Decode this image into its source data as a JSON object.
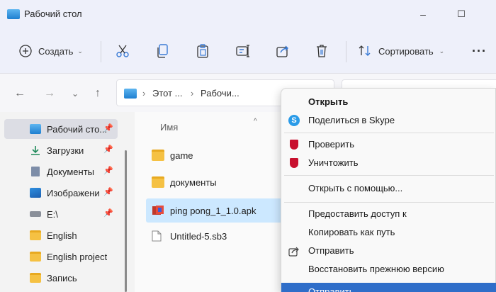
{
  "window": {
    "title": "Рабочий стол",
    "minimize": "–",
    "maximize": "☐"
  },
  "toolbar": {
    "create_label": "Создать",
    "sort_label": "Сортировать",
    "more": "···"
  },
  "nav": {
    "back": "←",
    "forward": "→",
    "recent": "⌄",
    "up": "↑",
    "breadcrumb_sep": "›",
    "breadcrumb": [
      "Этот ...",
      "Рабочи..."
    ]
  },
  "sidebar": {
    "items": [
      {
        "label": "Рабочий сто...",
        "icon": "desktop-icon",
        "pinned": true,
        "selected": true
      },
      {
        "label": "Загрузки",
        "icon": "download-icon",
        "pinned": true
      },
      {
        "label": "Документы",
        "icon": "documents-icon",
        "pinned": true
      },
      {
        "label": "Изображени",
        "icon": "pictures-icon",
        "pinned": true
      },
      {
        "label": "E:\\",
        "icon": "drive-icon",
        "pinned": true
      },
      {
        "label": "English",
        "icon": "folder-icon",
        "pinned": false
      },
      {
        "label": "English project",
        "icon": "folder-icon",
        "pinned": false
      },
      {
        "label": "Запись",
        "icon": "folder-icon",
        "pinned": false
      }
    ],
    "pin_glyph": "📌"
  },
  "filelist": {
    "column_name": "Имя",
    "sort_caret": "^",
    "files": [
      {
        "name": "game",
        "icon": "folder-icon"
      },
      {
        "name": "документы",
        "icon": "folder-icon"
      },
      {
        "name": "ping pong_1_1.0.apk",
        "icon": "apk-icon",
        "selected": true
      },
      {
        "name": "Untitled-5.sb3",
        "icon": "file-icon"
      }
    ]
  },
  "context_menu": {
    "items": [
      {
        "label": "Открыть",
        "bold": true
      },
      {
        "label": "Поделиться в Skype",
        "icon": "skype-icon"
      },
      {
        "label": "Проверить",
        "icon": "mcafee-icon"
      },
      {
        "label": "Уничтожить",
        "icon": "mcafee-icon"
      },
      {
        "label": "Открыть с помощью..."
      },
      {
        "label": "Предоставить доступ к"
      },
      {
        "label": "Копировать как путь"
      },
      {
        "label": "Отправить",
        "icon": "share-icon"
      },
      {
        "label": "Восстановить прежнюю версию"
      },
      {
        "label": "Отправить",
        "highlight": true
      }
    ]
  },
  "colors": {
    "accent": "#2f6ec9",
    "selection": "#cce8ff",
    "folder": "#f5c143"
  }
}
